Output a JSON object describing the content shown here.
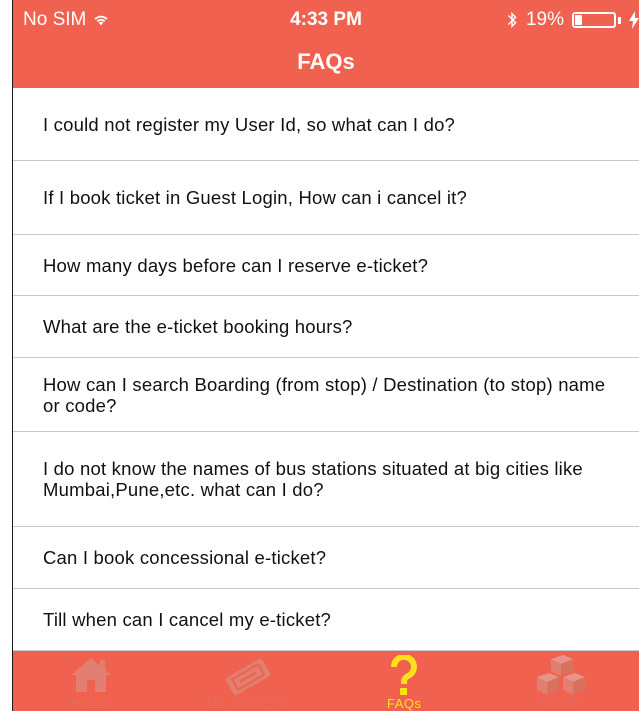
{
  "status_bar": {
    "carrier": "No SIM",
    "time": "4:33 PM",
    "battery": "19%",
    "battery_level": 0.19,
    "icons": [
      "wifi-icon",
      "bluetooth-icon",
      "battery-icon",
      "charging-bolt-icon"
    ]
  },
  "nav": {
    "title": "FAQs"
  },
  "faqs": [
    "I could not register my User Id, so what can I do?",
    "If I book ticket in Guest Login, How can i cancel it?",
    "How many days before can I reserve e-ticket?",
    "What are the e-ticket booking hours?",
    "How can I search Boarding (from stop) / Destination (to stop) name or code?",
    "I do not know the names of bus stations situated at big cities like Mumbai,Pune,etc. what can I do?",
    "Can I book concessional e-ticket?",
    "Till when can I cancel my e-ticket?"
  ],
  "tabs": [
    {
      "label": "HOME",
      "icon": "home-icon",
      "active": false
    },
    {
      "label": "MY TICKETS",
      "icon": "ticket-icon",
      "active": false
    },
    {
      "label": "FAQs",
      "icon": "question-icon",
      "active": true
    },
    {
      "label": "MORE",
      "icon": "boxes-icon",
      "active": false
    }
  ],
  "colors": {
    "accent": "#f0624f",
    "active_tab": "#ffe21a",
    "inactive_tab_icon": "#e27f70"
  }
}
